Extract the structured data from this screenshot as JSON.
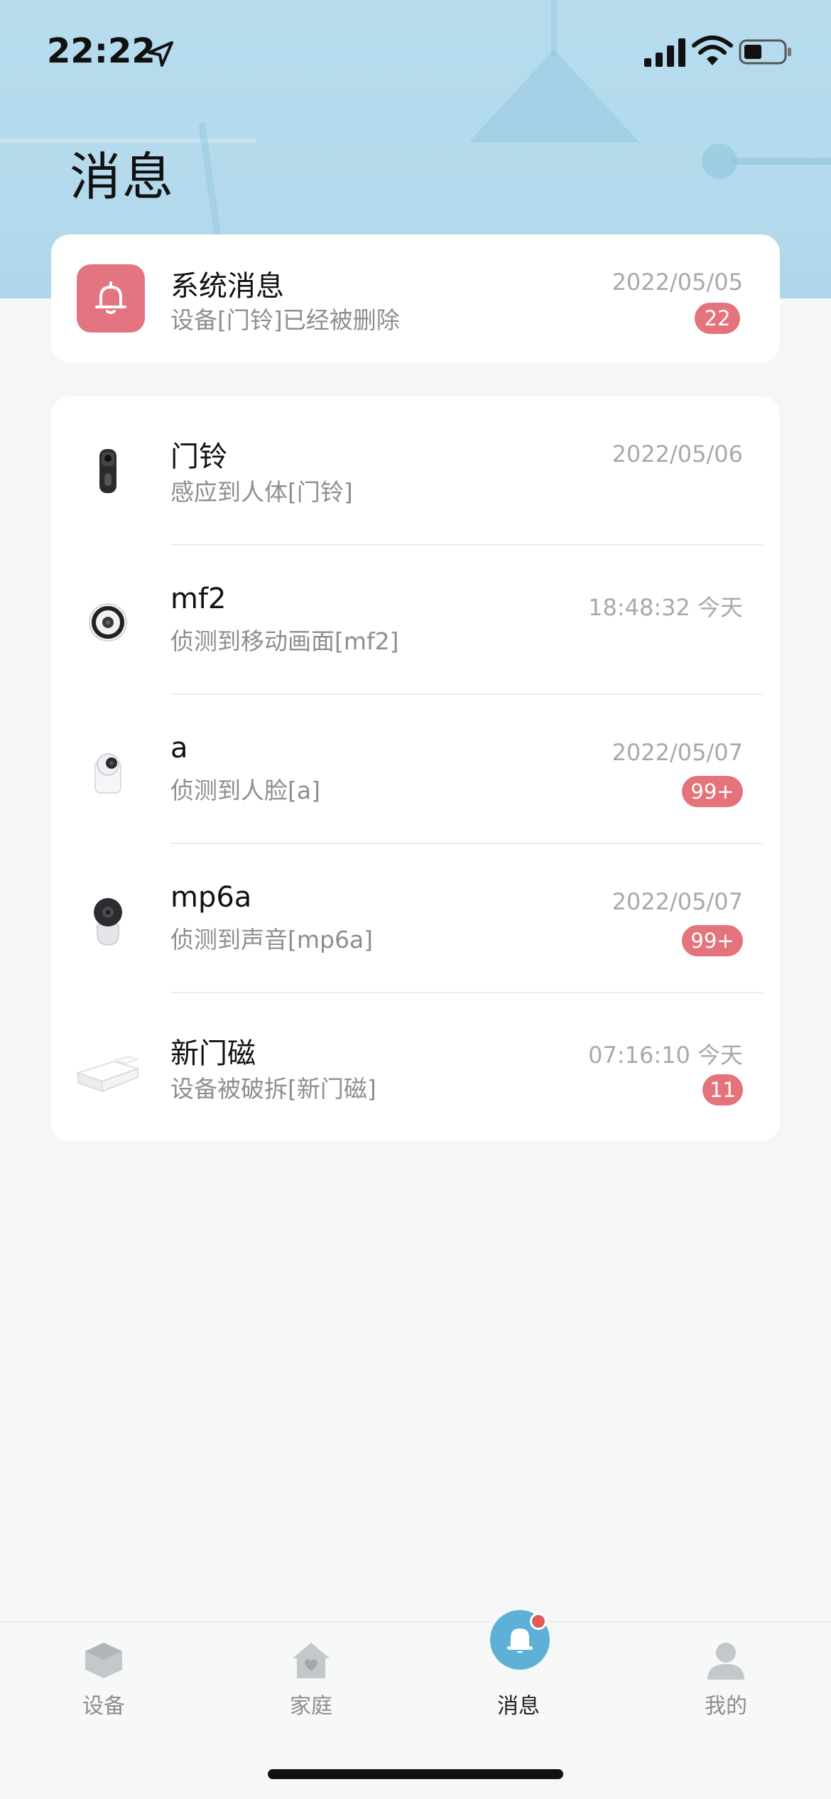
{
  "status_bar": {
    "time": "22:22"
  },
  "page": {
    "title": "消息"
  },
  "system_message": {
    "title": "系统消息",
    "subtitle": "设备[门铃]已经被删除",
    "date": "2022/05/05",
    "badge": "22"
  },
  "devices": [
    {
      "name": "门铃",
      "event": "感应到人体[门铃]",
      "date": "2022/05/06",
      "badge": "",
      "icon": "doorbell-icon"
    },
    {
      "name": "mf2",
      "event": "侦测到移动画面[mf2]",
      "date": "18:48:32 今天",
      "badge": "",
      "icon": "fisheye-camera-icon"
    },
    {
      "name": "a",
      "event": "侦测到人脸[a]",
      "date": "2022/05/07",
      "badge": "99+",
      "icon": "cube-camera-icon"
    },
    {
      "name": "mp6a",
      "event": "侦测到声音[mp6a]",
      "date": "2022/05/07",
      "badge": "99+",
      "icon": "dome-camera-icon"
    },
    {
      "name": "新门磁",
      "event": "设备被破拆[新门磁]",
      "date": "07:16:10 今天",
      "badge": "11",
      "icon": "door-sensor-icon"
    }
  ],
  "tabs": [
    {
      "label": "设备",
      "icon": "device-cube-icon",
      "active": false
    },
    {
      "label": "家庭",
      "icon": "home-heart-icon",
      "active": false
    },
    {
      "label": "消息",
      "icon": "bell-icon",
      "active": true
    },
    {
      "label": "我的",
      "icon": "person-icon",
      "active": false
    }
  ],
  "colors": {
    "accent": "#5eb1d6",
    "badge": "#e4737b",
    "system_icon_bg": "#e27580",
    "header_bg": "#b3daec"
  }
}
